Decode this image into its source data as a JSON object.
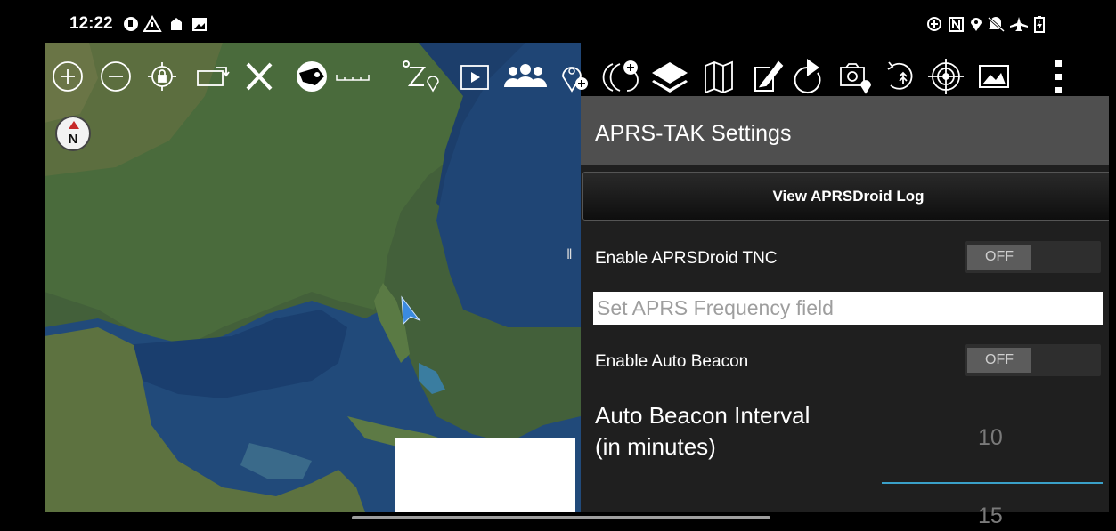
{
  "status_bar": {
    "time": "12:22",
    "left_icons": [
      "app-notification-icon",
      "warning-icon",
      "tak-icon",
      "image-icon"
    ],
    "right_icons": [
      "data-saver-icon",
      "nfc-icon",
      "location-icon",
      "silent-icon",
      "airplane-mode-icon",
      "battery-charging-icon"
    ]
  },
  "map": {
    "compass_label": "N",
    "handle_glyph": "‖"
  },
  "toolbar": {
    "left_tools": [
      "zoom-in-icon",
      "zoom-out-icon",
      "lock-location-icon",
      "rotate-icon",
      "close-icon",
      "mascot-icon",
      "scale-bar-icon",
      "elevation-icon",
      "video-icon",
      "contacts-icon",
      "add-location-icon"
    ],
    "right_tools": [
      "add-overlay-icon",
      "layers-icon",
      "map-icon",
      "edit-icon",
      "tap-icon",
      "camera-location-icon",
      "history-icon",
      "target-icon",
      "image-gallery-icon",
      "overflow-menu-icon"
    ]
  },
  "panel": {
    "title": "APRS-TAK Settings",
    "view_log_button": "View APRSDroid Log",
    "enable_tnc_label": "Enable APRSDroid TNC",
    "enable_tnc_state": "OFF",
    "frequency_placeholder": "Set APRS Frequency field",
    "auto_beacon_label": "Enable Auto Beacon",
    "auto_beacon_state": "OFF",
    "interval_label_line1": "Auto Beacon Interval",
    "interval_label_line2": "(in minutes)",
    "interval_values": [
      "10",
      "15"
    ]
  },
  "colors": {
    "panel_bg": "#1f1f1f",
    "header_bg": "#4f4f4f",
    "accent": "#3aa0c8",
    "cursor": "#3b8be0"
  }
}
